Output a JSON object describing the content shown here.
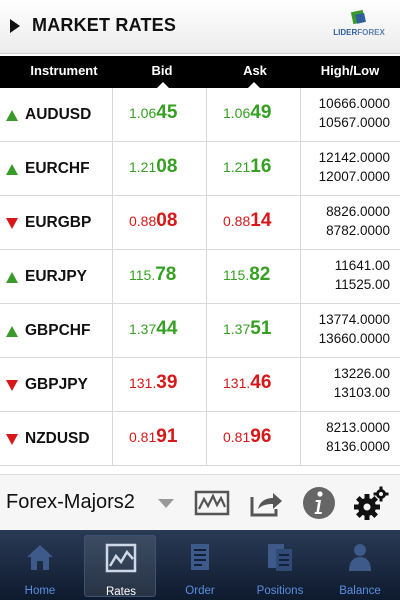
{
  "header": {
    "title": "MARKET RATES",
    "logo_text_a": "LIDER",
    "logo_text_b": "FOREX"
  },
  "columns": {
    "instrument": "Instrument",
    "bid": "Bid",
    "ask": "Ask",
    "high_low": "High/Low"
  },
  "rows": [
    {
      "symbol": "AUDUSD",
      "direction": "up",
      "bid_small": "1.06",
      "bid_big": "45",
      "ask_small": "1.06",
      "ask_big": "49",
      "high": "10666.0000",
      "low": "10567.0000"
    },
    {
      "symbol": "EURCHF",
      "direction": "up",
      "bid_small": "1.21",
      "bid_big": "08",
      "ask_small": "1.21",
      "ask_big": "16",
      "high": "12142.0000",
      "low": "12007.0000"
    },
    {
      "symbol": "EURGBP",
      "direction": "down",
      "bid_small": "0.88",
      "bid_big": "08",
      "ask_small": "0.88",
      "ask_big": "14",
      "high": "8826.0000",
      "low": "8782.0000"
    },
    {
      "symbol": "EURJPY",
      "direction": "up",
      "bid_small": "115.",
      "bid_big": "78",
      "ask_small": "115.",
      "ask_big": "82",
      "high": "11641.00",
      "low": "11525.00"
    },
    {
      "symbol": "GBPCHF",
      "direction": "up",
      "bid_small": "1.37",
      "bid_big": "44",
      "ask_small": "1.37",
      "ask_big": "51",
      "high": "13774.0000",
      "low": "13660.0000"
    },
    {
      "symbol": "GBPJPY",
      "direction": "down",
      "bid_small": "131.",
      "bid_big": "39",
      "ask_small": "131.",
      "ask_big": "46",
      "high": "13226.00",
      "low": "13103.00"
    },
    {
      "symbol": "NZDUSD",
      "direction": "down",
      "bid_small": "0.81",
      "bid_big": "91",
      "ask_small": "0.81",
      "ask_big": "96",
      "high": "8213.0000",
      "low": "8136.0000"
    }
  ],
  "toolbar": {
    "list_name": "Forex-Majors2",
    "icons": [
      "chart-icon",
      "share-icon",
      "info-icon",
      "settings-icon"
    ]
  },
  "nav": {
    "items": [
      {
        "label": "Home",
        "icon": "home-icon"
      },
      {
        "label": "Rates",
        "icon": "rates-chart-icon",
        "active": true
      },
      {
        "label": "Order",
        "icon": "order-icon"
      },
      {
        "label": "Positions",
        "icon": "positions-icon"
      },
      {
        "label": "Balance",
        "icon": "balance-icon"
      }
    ]
  },
  "colors": {
    "up": "#35a022",
    "down": "#d81818",
    "nav_bg": "#0e1a2e",
    "nav_label": "#5a8fe0"
  }
}
